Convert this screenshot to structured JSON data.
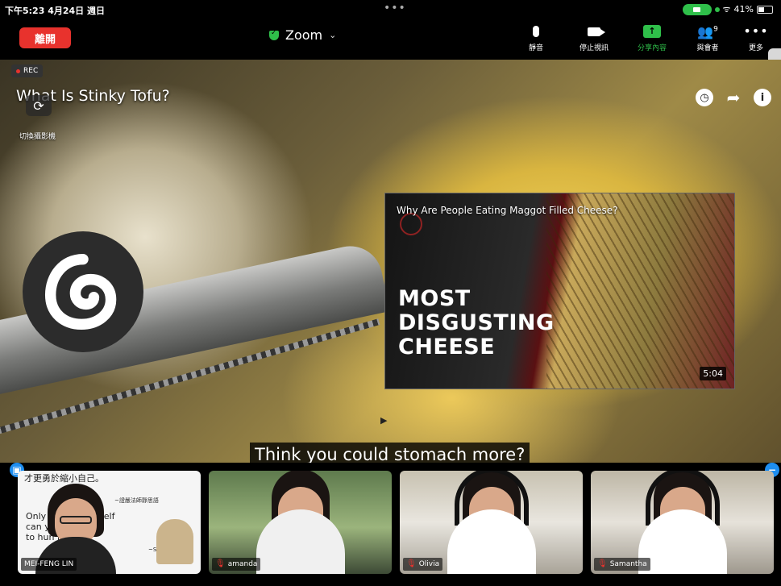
{
  "status_bar": {
    "time": "下午5:23  4月24日 週日",
    "battery": "41%"
  },
  "toolbar": {
    "leave_label": "離開",
    "meeting_title": "Zoom",
    "mute_label": "靜音",
    "stop_video_label": "停止視訊",
    "share_label": "分享內容",
    "participants_label": "與會者",
    "participants_count": "9",
    "more_label": "更多"
  },
  "screen": {
    "rec_label": "REC",
    "video_title": "What Is Stinky Tofu?",
    "camera_switch_label": "切換攝影機",
    "end_card": {
      "title": "Why Are People Eating Maggot Filled Cheese?",
      "headline_1": "MOST",
      "headline_2": "DISGUSTING",
      "headline_3": "CHEESE",
      "duration": "5:04"
    },
    "caption": "Think you could stomach more?"
  },
  "participants": [
    {
      "name": "MEI-FENG LIN",
      "poster_line_1": "才更勇於縮小自己。",
      "poster_line_2": "~證嚴法師靜思語",
      "quote_1": "Only y      pect yourself",
      "quote_2": "can y       courage",
      "quote_3": "to hun      lf.",
      "quote_src": "~Still Thoughts"
    },
    {
      "name": "amanda"
    },
    {
      "name": "Olivia"
    },
    {
      "name": "Samantha"
    }
  ],
  "colors": {
    "leave_red": "#e8322d",
    "share_green": "#2fbf4a",
    "accent_blue": "#1e8ef0"
  }
}
